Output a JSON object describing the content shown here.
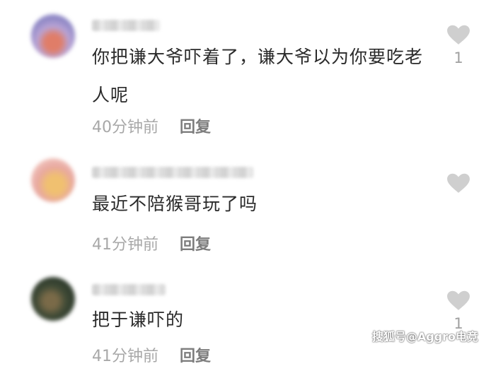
{
  "comments": [
    {
      "text": "你把谦大爷吓着了，谦大爷以为你要吃老人呢",
      "time": "40分钟前",
      "reply_label": "回复",
      "like_count": "1"
    },
    {
      "text": "最近不陪猴哥玩了吗",
      "time": "41分钟前",
      "reply_label": "回复",
      "like_count": ""
    },
    {
      "text": "把于谦吓的",
      "time": "41分钟前",
      "reply_label": "回复",
      "like_count": "1"
    }
  ],
  "watermark": "搜狐号@Aggro电竞",
  "icons": {
    "like": "heart-icon"
  },
  "colors": {
    "heart": "#cfcfcf",
    "meta": "#a8a8a8",
    "text": "#2a2a2a"
  }
}
